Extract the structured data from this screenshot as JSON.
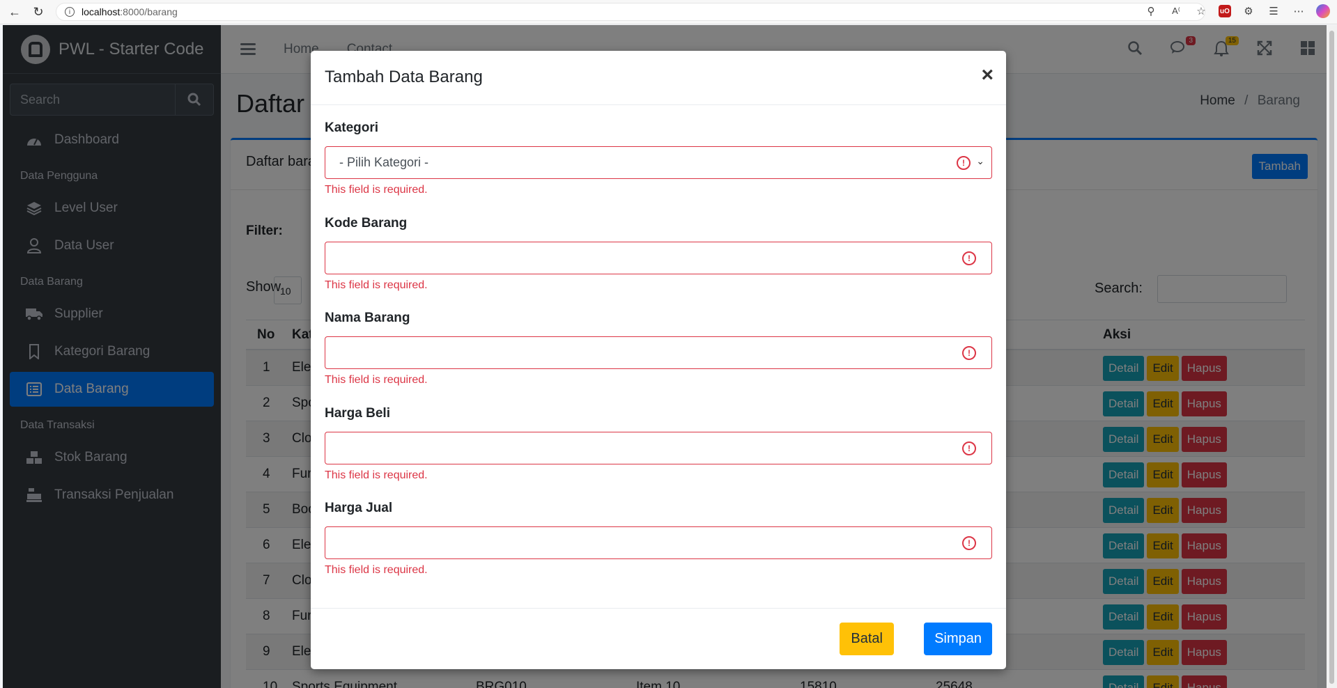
{
  "browser": {
    "url_host": "localhost",
    "url_path": ":8000/barang"
  },
  "sidebar": {
    "brand": "PWL - Starter Code",
    "search_placeholder": "Search",
    "items": [
      {
        "label": "Dashboard",
        "icon": "dashboard-icon"
      },
      {
        "header": "Data Pengguna"
      },
      {
        "label": "Level User",
        "icon": "layers-icon"
      },
      {
        "label": "Data User",
        "icon": "user-icon"
      },
      {
        "header": "Data Barang"
      },
      {
        "label": "Supplier",
        "icon": "truck-icon"
      },
      {
        "label": "Kategori Barang",
        "icon": "bookmark-icon"
      },
      {
        "label": "Data Barang",
        "icon": "list-icon",
        "active": true
      },
      {
        "header": "Data Transaksi"
      },
      {
        "label": "Stok Barang",
        "icon": "cubes-icon"
      },
      {
        "label": "Transaksi Penjualan",
        "icon": "cash-register-icon"
      }
    ]
  },
  "topnav": {
    "links": [
      "Home",
      "Contact"
    ],
    "messages_badge": "3",
    "notifications_badge": "15"
  },
  "page": {
    "title": "Daftar B",
    "breadcrumb_home": "Home",
    "breadcrumb_sep": "/",
    "breadcrumb_current": "Barang",
    "card_title": "Daftar bara",
    "tambah_button": "Tambah",
    "filter_label": "Filter:",
    "show_label": "Show",
    "show_value": "10",
    "search_label": "Search:"
  },
  "table": {
    "headers": {
      "no": "No",
      "kategori": "Kat",
      "aksi": "Aksi"
    },
    "rows": [
      {
        "no": "1",
        "kategori": "Ele"
      },
      {
        "no": "2",
        "kategori": "Spo"
      },
      {
        "no": "3",
        "kategori": "Clo"
      },
      {
        "no": "4",
        "kategori": "Fur"
      },
      {
        "no": "5",
        "kategori": "Boo"
      },
      {
        "no": "6",
        "kategori": "Ele"
      },
      {
        "no": "7",
        "kategori": "Clo"
      },
      {
        "no": "8",
        "kategori": "Fur"
      },
      {
        "no": "9",
        "kategori": "Ele"
      },
      {
        "no": "10",
        "kategori": "Sports Equipment",
        "kode": "BRG010",
        "nama": "Item 10",
        "beli": "15810",
        "jual": "25648"
      }
    ],
    "action_labels": {
      "detail": "Detail",
      "edit": "Edit",
      "hapus": "Hapus"
    }
  },
  "modal": {
    "title": "Tambah Data Barang",
    "close": "×",
    "fields": [
      {
        "label": "Kategori",
        "value": "- Pilih Kategori -",
        "type": "select",
        "error": "This field is required."
      },
      {
        "label": "Kode Barang",
        "value": "",
        "type": "text",
        "error": "This field is required."
      },
      {
        "label": "Nama Barang",
        "value": "",
        "type": "text",
        "error": "This field is required."
      },
      {
        "label": "Harga Beli",
        "value": "",
        "type": "text",
        "error": "This field is required."
      },
      {
        "label": "Harga Jual",
        "value": "",
        "type": "text",
        "error": "This field is required."
      }
    ],
    "batal_button": "Batal",
    "simpan_button": "Simpan"
  },
  "colors": {
    "primary": "#007bff",
    "danger": "#dc3545",
    "warning": "#ffc107",
    "info": "#17a2b8",
    "sidebar": "#343a40"
  }
}
